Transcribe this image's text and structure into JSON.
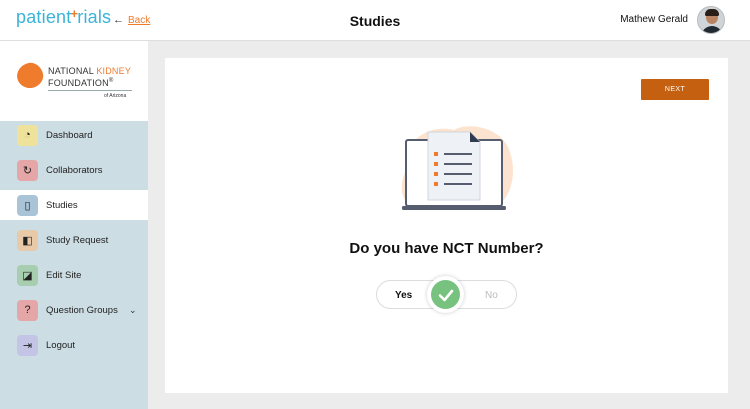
{
  "header": {
    "logo_before": "patient",
    "logo_plus": "+",
    "logo_after": "rials",
    "back_arrow": "←",
    "back_label": "Back",
    "title": "Studies",
    "user_name": "Mathew Gerald"
  },
  "organization": {
    "line1_a": "NATIONAL",
    "line1_b": "KIDNEY",
    "line2": "FOUNDATION",
    "line2_mark": "®",
    "line3": "of Arizona"
  },
  "sidebar": {
    "items": [
      {
        "label": "Dashboard",
        "icon": "dashboard-gauge-icon",
        "color": "#efe29a",
        "glyph": "◔"
      },
      {
        "label": "Collaborators",
        "icon": "collaborators-cycle-icon",
        "color": "#e5a6a8",
        "glyph": "↻"
      },
      {
        "label": "Studies",
        "icon": "studies-notebook-icon",
        "color": "#a9c4d6",
        "glyph": "▯"
      },
      {
        "label": "Study Request",
        "icon": "study-request-layout-icon",
        "color": "#e8caa8",
        "glyph": "◧"
      },
      {
        "label": "Edit Site",
        "icon": "edit-site-monitor-icon",
        "color": "#a8ceb0",
        "glyph": "◪"
      },
      {
        "label": "Question Groups",
        "icon": "question-groups-icon",
        "color": "#e5a6a8",
        "glyph": "?"
      },
      {
        "label": "Logout",
        "icon": "logout-icon",
        "color": "#c4c4e6",
        "glyph": "⇥"
      }
    ],
    "active_index": 2,
    "expand_glyph": "⌄"
  },
  "main": {
    "next_label": "NEXT",
    "question": "Do you have NCT Number?",
    "toggle": {
      "yes_label": "Yes",
      "no_label": "No",
      "selected": "Yes"
    }
  },
  "colors": {
    "accent": "#ef7b2d",
    "next_button": "#c4600f",
    "logo_blue": "#3bb3d8",
    "sidebar_bg": "#cddde4",
    "toggle_check": "#77c27f"
  }
}
